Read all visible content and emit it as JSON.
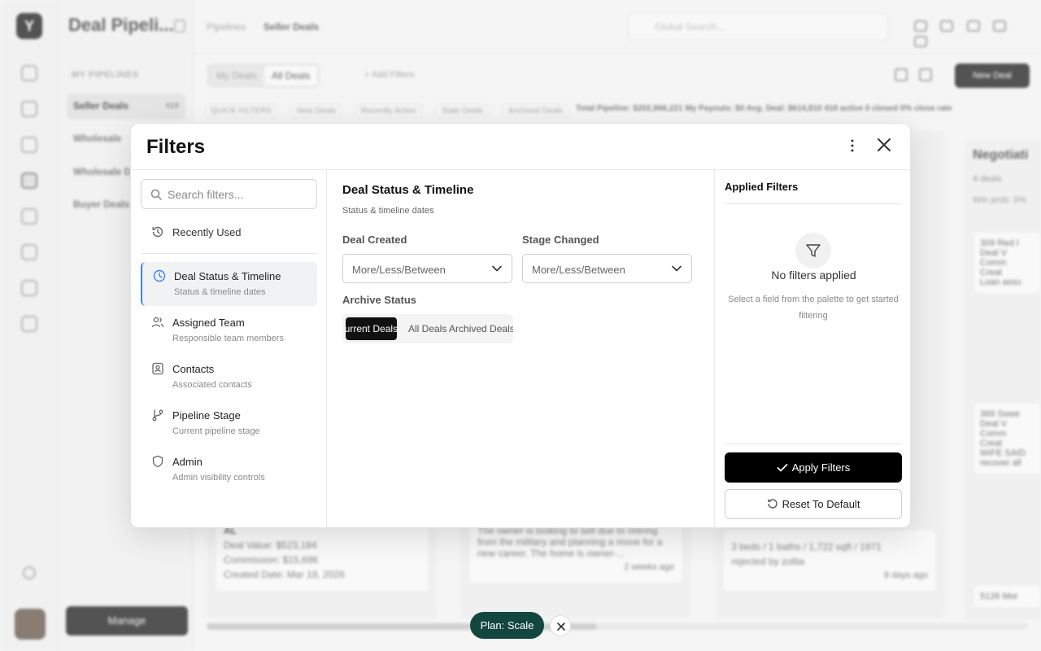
{
  "app": {
    "title": "Deal Pipeli...",
    "logo_glyph": "Y",
    "breadcrumb": [
      "Pipelines",
      "Seller Deals"
    ],
    "global_search_placeholder": "Global Search...",
    "pipelines_heading": "MY PIPELINES",
    "pipelines": [
      {
        "label": "Seller Deals",
        "count": "418",
        "selected": true
      },
      {
        "label": "Wholesale"
      },
      {
        "label": "Wholesale D..."
      },
      {
        "label": "Buyer Deals"
      }
    ],
    "manage_label": "Manage",
    "deal_tabs": [
      "My Deals",
      "All Deals"
    ],
    "add_filters_label": "+ Add Filters",
    "new_deal_label": "New Deal",
    "quick_filters": [
      "QUICK FILTERS",
      "New Deals",
      "Recently Active",
      "Stale Deals",
      "Archived Deals"
    ],
    "stats_text": "Total Pipeline: $202,866,221   My Payouts: $0   Avg. Deal: $614,810   418 active   0 closed   0% close rate",
    "cards": [
      {
        "title": "AL",
        "value": "Deal Value: $523,184",
        "commission": "Commission: $15,696",
        "created": "Created Date: Mar 18, 2026"
      },
      {
        "text": "The owner is looking to sell due to retiring from the military and planning a move for a new career. The home is owner-...",
        "age": "2 weeks ago"
      },
      {
        "text": "3 beds / 1 baths / 1,722 sqft / 1971",
        "note": "rejected by zoltia",
        "age": "8 days ago"
      }
    ],
    "negotiation": {
      "title": "Negotiati",
      "count": "4 deals",
      "win_prob": "Win prob: 0%",
      "cards": [
        "309 Red I",
        "Deal V",
        "Comm",
        "Creat",
        "Loan assu",
        "369 Swee",
        "Deal V",
        "Comm",
        "Creat",
        "WIFE SAID",
        "recover all",
        "5126 Mor"
      ]
    }
  },
  "modal": {
    "title": "Filters",
    "search_placeholder": "Search filters...",
    "recently_used": "Recently Used",
    "categories": [
      {
        "label": "Deal Status & Timeline",
        "sub": "Status & timeline dates",
        "icon": "clock-icon",
        "active": true
      },
      {
        "label": "Assigned Team",
        "sub": "Responsible team members",
        "icon": "users-icon"
      },
      {
        "label": "Contacts",
        "sub": "Associated contacts",
        "icon": "contact-card-icon"
      },
      {
        "label": "Pipeline Stage",
        "sub": "Current pipeline stage",
        "icon": "git-branch-icon"
      },
      {
        "label": "Admin",
        "sub": "Admin visibility controls",
        "icon": "shield-icon"
      }
    ],
    "section": {
      "title": "Deal Status & Timeline",
      "subtitle": "Status & timeline dates",
      "deal_created_label": "Deal Created",
      "deal_created_value": "More/Less/Between",
      "stage_changed_label": "Stage Changed",
      "stage_changed_value": "More/Less/Between",
      "archive_label": "Archive Status",
      "archive_options": [
        "Current Deals",
        "All Deals",
        "Archived Deals"
      ],
      "archive_selected": "Current Deals"
    },
    "applied": {
      "title": "Applied Filters",
      "empty_title": "No filters applied",
      "empty_text": "Select a field from the palette to get started filtering",
      "apply_label": "Apply Filters",
      "reset_label": "Reset To Default"
    }
  },
  "plan": {
    "label": "Plan: Scale"
  },
  "colors": {
    "accent": "#3b82f6",
    "primary_button": "#000000",
    "plan_pill": "#13463f"
  }
}
